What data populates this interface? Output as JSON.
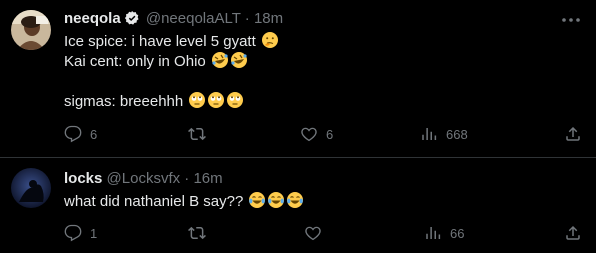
{
  "tweets": [
    {
      "author_name": "neeqola",
      "handle": "@neeqolaALT",
      "time_sep": "·",
      "time": "18m",
      "verified": true,
      "lines": [
        "Ice spice: i have level 5 gyatt",
        "Kai cent: only in Ohio",
        "sigmas: breeehhh"
      ],
      "stats": {
        "replies": "6",
        "retweets": "",
        "likes": "6",
        "views": "668"
      }
    },
    {
      "author_name": "locks",
      "handle": "@Locksvfx",
      "time_sep": "·",
      "time": "16m",
      "verified": false,
      "lines": [
        "what did nathaniel B say??"
      ],
      "stats": {
        "replies": "1",
        "retweets": "",
        "likes": "",
        "views": "66"
      }
    }
  ],
  "colors": {
    "background": "#000000",
    "text": "#e7e9ea",
    "muted": "#71767b",
    "divider": "#2f3336"
  },
  "icons": [
    "more-icon",
    "verified-badge-icon",
    "reply-icon",
    "retweet-icon",
    "like-icon",
    "views-icon",
    "share-icon",
    "thinking-emoji",
    "rofl-emoji",
    "eye-roll-emoji",
    "tears-of-joy-emoji"
  ]
}
